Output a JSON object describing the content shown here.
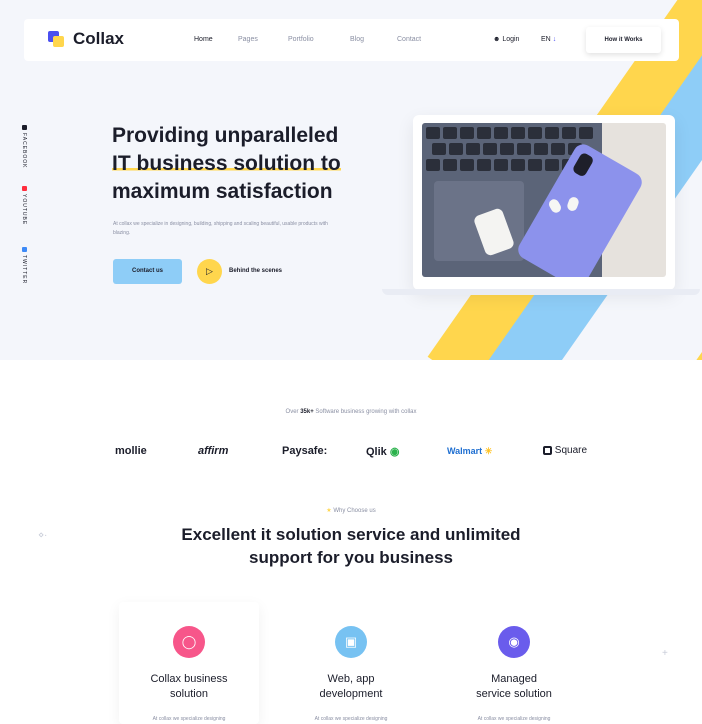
{
  "brand": {
    "name": "Collax"
  },
  "nav": {
    "links": [
      "Home",
      "Pages",
      "Portfolio",
      "Blog",
      "Contact"
    ],
    "login": "Login",
    "language": "EN",
    "cta": "How it Works"
  },
  "social": [
    "FACEBOOK",
    "YOUTUBE",
    "TWITTER"
  ],
  "hero": {
    "title_line1": "Providing unparalleled",
    "title_line2": "IT business solution to",
    "title_line3": "maximum satisfaction",
    "description": "At collax we specialize in designing, building, shipping and scaling beautiful, usable products with blazing.",
    "primary_button": "Contact us",
    "secondary_button": "Behind the scenes"
  },
  "stats": {
    "prefix": "Over",
    "count": "35k+",
    "suffix": "Software business growing with collax"
  },
  "partners": [
    "mollie",
    "affirm",
    "Paysafe:",
    "Qlik",
    "Walmart",
    "Square"
  ],
  "why": {
    "eyebrow": "Why Choose us",
    "title_line1": "Excellent it solution service and unlimited",
    "title_line2": "support for you business"
  },
  "services": [
    {
      "title_line1": "Collax business",
      "title_line2": "solution",
      "desc": "At collax we specialize designing",
      "icon": "bulb-icon",
      "color": "#f7568a"
    },
    {
      "title_line1": "Web, app",
      "title_line2": "development",
      "desc": "At collax we specialize designing",
      "icon": "code-file-icon",
      "color": "#77c2f2"
    },
    {
      "title_line1": "Managed",
      "title_line2": "service solution",
      "desc": "At collax we specialize designing",
      "icon": "camera-icon",
      "color": "#6a5cec"
    }
  ],
  "colors": {
    "yellow": "#ffd64d",
    "blue": "#8ecdf7",
    "dark": "#1b1d2a",
    "accent": "#4a4ff0"
  }
}
